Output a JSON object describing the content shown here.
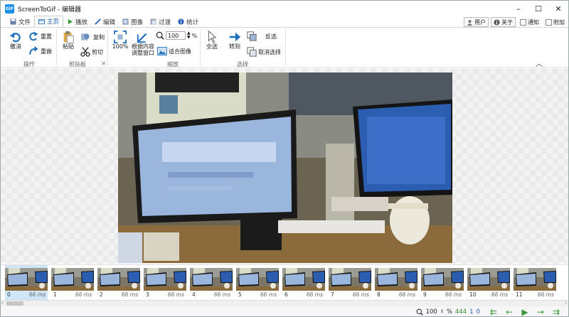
{
  "window": {
    "title": "ScreenToGif - 编辑器",
    "app_icon_text": "GIF"
  },
  "tabs": [
    {
      "label": "文件",
      "icon": "save-icon"
    },
    {
      "label": "主页",
      "icon": "home-icon",
      "active": true
    },
    {
      "label": "播放",
      "icon": "play-icon"
    },
    {
      "label": "编辑",
      "icon": "pencil-icon"
    },
    {
      "label": "图像",
      "icon": "image-icon"
    },
    {
      "label": "过渡",
      "icon": "transition-icon"
    },
    {
      "label": "统计",
      "icon": "info-icon"
    }
  ],
  "right_tabs": {
    "user": "用户",
    "about": "关于",
    "notice": "通知",
    "attach": "附加"
  },
  "ribbon": {
    "undo": "撤消",
    "redo": "重置",
    "reset": "重做",
    "paste": "粘贴",
    "copy": "复制",
    "cut": "剪切",
    "zoom_100": "100%",
    "fit_window": "根据内容\n调整窗口",
    "zoom_value": "100",
    "zoom_unit": "%",
    "fit_image": "适合图像",
    "select_all": "全选",
    "goto": "转到",
    "invert": "反选",
    "deselect": "取消选择",
    "groups": {
      "actions": "操作",
      "clipboard": "剪贴板",
      "zoom": "缩放",
      "select": "选择"
    }
  },
  "frames": [
    {
      "index": "0",
      "delay": "66 ms"
    },
    {
      "index": "1",
      "delay": "66 ms"
    },
    {
      "index": "2",
      "delay": "66 ms"
    },
    {
      "index": "3",
      "delay": "66 ms"
    },
    {
      "index": "4",
      "delay": "66 ms"
    },
    {
      "index": "5",
      "delay": "66 ms"
    },
    {
      "index": "6",
      "delay": "66 ms"
    },
    {
      "index": "7",
      "delay": "66 ms"
    },
    {
      "index": "8",
      "delay": "66 ms"
    },
    {
      "index": "9",
      "delay": "66 ms"
    },
    {
      "index": "10",
      "delay": "66 ms"
    },
    {
      "index": "11",
      "delay": "66 ms"
    }
  ],
  "status": {
    "zoom": "100",
    "zoom_unit": "%",
    "frame_count": "444",
    "selected": "1",
    "current": "0"
  },
  "colors": {
    "accent": "#1f6fbf",
    "nav_green": "#3a9a3a"
  }
}
